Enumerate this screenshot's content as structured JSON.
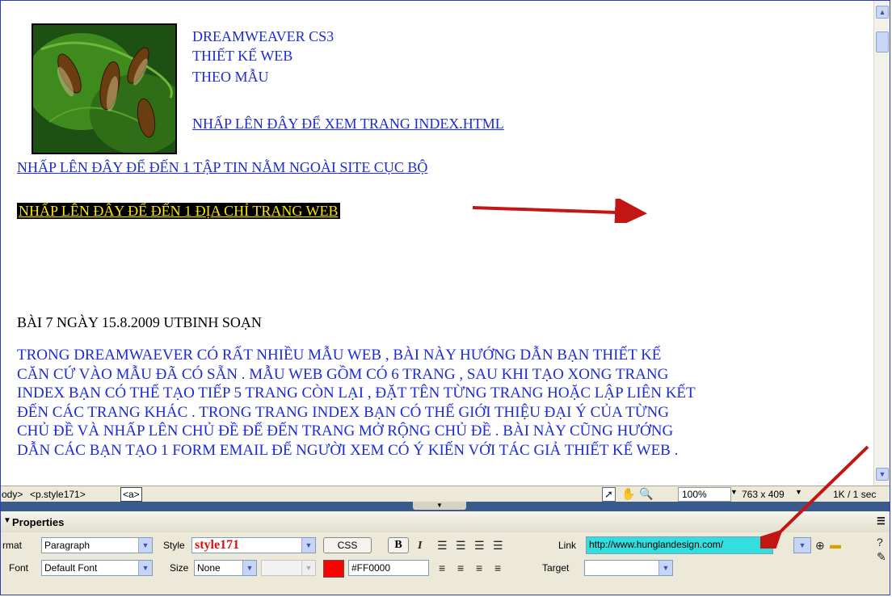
{
  "document": {
    "heading_lines": [
      "DREAMWEAVER CS3",
      "THIẾT KẾ WEB",
      "THEO MẪU"
    ],
    "link_index": "NHẤP LÊN ĐÂY ĐỂ XEM TRANG INDEX.HTML",
    "link_local": "NHẤP LÊN ĐÂY ĐỂ ĐẾN 1 TẬP TIN NẰM NGOÀI SITE CỤC BỘ",
    "link_web": "NHẤP LÊN ĐÂY ĐỂ ĐẾN 1 ĐỊA CHỈ TRANG WEB",
    "lesson_title": "BÀI 7 NGÀY 15.8.2009 UTBINH SOẠN",
    "paragraph_lines": [
      "TRONG DREAMWAEVER CÓ RẤT NHIỀU MẪU WEB , BÀI NÀY HƯỚNG DẪN BẠN THIẾT KẾ",
      "CĂN CỨ VÀO MẪU ĐÃ CÓ SẴN . MẪU WEB GỒM CÓ 6 TRANG , SAU KHI TẠO XONG TRANG",
      "INDEX BẠN CÓ THỂ TẠO TIẾP 5 TRANG CÒN LẠI , ĐẶT TÊN TỪNG TRANG HOẶC LẬP LIÊN KẾT",
      "ĐẾN CÁC TRANG KHÁC . TRONG TRANG INDEX BẠN CÓ THỂ GIỚI THIỆU ĐẠI Ý CỦA TỪNG",
      "CHỦ ĐỀ VÀ NHẤP LÊN CHỦ ĐỀ ĐỂ ĐẾN TRANG MỞ RỘNG CHỦ ĐỀ . BÀI NÀY CŨNG HƯỚNG",
      "DẪN CÁC BẠN TẠO 1 FORM EMAIL ĐỂ NGƯỜI XEM CÓ Ý KIẾN VỚI TÁC GIẢ THIẾT KẾ WEB ."
    ]
  },
  "status_bar": {
    "tag_body": "ody>",
    "tag_p": "<p.style171>",
    "tag_a": "<a>",
    "zoom": "100%",
    "dimensions": "763 x 409",
    "download": "1K / 1 sec"
  },
  "properties": {
    "title": "Properties",
    "format_label": "rmat",
    "format_value": "Paragraph",
    "style_label": "Style",
    "style_value": "style171",
    "css_button": "CSS",
    "bold_button": "B",
    "italic_button": "I",
    "link_label": "Link",
    "link_value": "http://www.hunglandesign.com/",
    "font_label": "Font",
    "font_value": "Default Font",
    "size_label": "Size",
    "size_value": "None",
    "color_value": "#FF0000",
    "target_label": "Target",
    "target_value": ""
  },
  "colors": {
    "link_blue": "#1c2bd6",
    "highlight_text": "#ffe600",
    "annotation_arrow": "#c41515",
    "style_red": "#e01010",
    "link_field_bg": "#33dede",
    "swatch": "#ff0000"
  }
}
